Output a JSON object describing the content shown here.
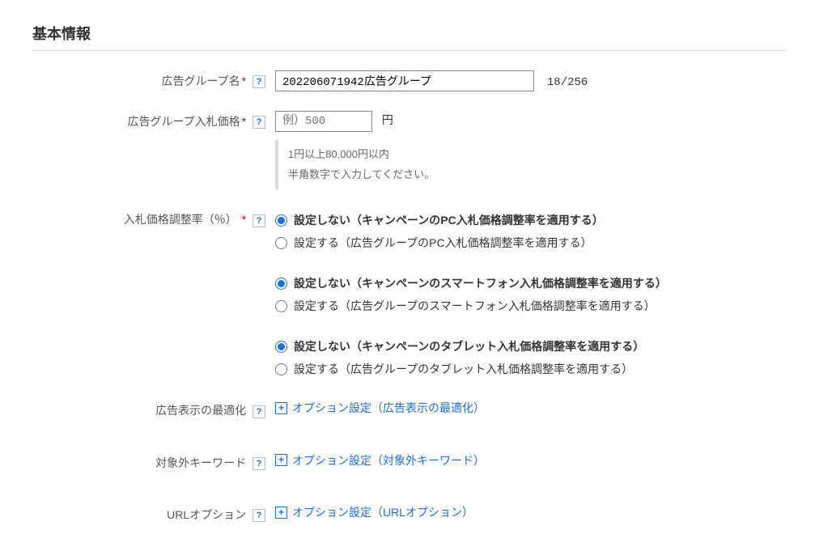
{
  "section_title": "基本情報",
  "fields": {
    "group_name": {
      "label": "広告グループ名",
      "required_mark": "*",
      "value": "202206071942広告グループ",
      "counter": "18/256"
    },
    "bid_price": {
      "label": "広告グループ入札価格",
      "required_mark": "*",
      "placeholder": "例）500",
      "unit": "円",
      "hint_line1": "1円以上80,000円以内",
      "hint_line2": "半角数字で入力してください。"
    },
    "bid_adjust": {
      "label": "入札価格調整率（％）",
      "required_mark": "*",
      "groups": [
        {
          "off": "設定しない（キャンペーンのPC入札価格調整率を適用する）",
          "on": "設定する（広告グループのPC入札価格調整率を適用する）"
        },
        {
          "off": "設定しない（キャンペーンのスマートフォン入札価格調整率を適用する）",
          "on": "設定する（広告グループのスマートフォン入札価格調整率を適用する）"
        },
        {
          "off": "設定しない（キャンペーンのタブレット入札価格調整率を適用する）",
          "on": "設定する（広告グループのタブレット入札価格調整率を適用する）"
        }
      ]
    },
    "ad_display_opt": {
      "label": "広告表示の最適化",
      "link": "オプション設定（広告表示の最適化）"
    },
    "negative_kw": {
      "label": "対象外キーワード",
      "link": "オプション設定（対象外キーワード）"
    },
    "url_option": {
      "label": "URLオプション",
      "link": "オプション設定（URLオプション）"
    }
  },
  "help_glyph": "?",
  "plus_glyph": "+"
}
